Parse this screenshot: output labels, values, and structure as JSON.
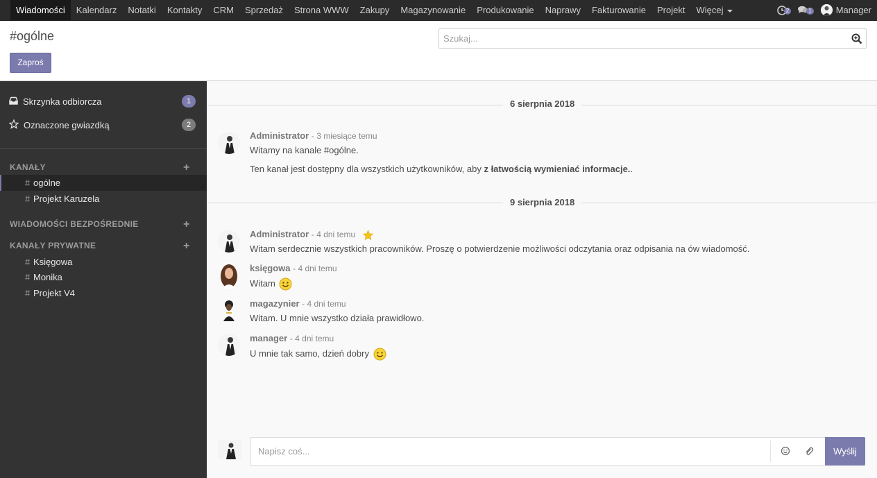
{
  "navbar": {
    "menu": [
      "Wiadomości",
      "Kalendarz",
      "Notatki",
      "Kontakty",
      "CRM",
      "Sprzedaż",
      "Strona WWW",
      "Zakupy",
      "Magazynowanie",
      "Produkowanie",
      "Naprawy",
      "Fakturowanie",
      "Projekt",
      "Więcej"
    ],
    "active_index": 0,
    "activity_count": "2",
    "messages_count": "1",
    "user_name": "Manager"
  },
  "control_panel": {
    "title": "#ogólne",
    "invite_label": "Zaproś",
    "search_placeholder": "Szukaj..."
  },
  "sidebar": {
    "mailboxes": [
      {
        "label": "Skrzynka odbiorcza",
        "count": "1",
        "color": "#7c7bad"
      },
      {
        "label": "Oznaczone gwiazdką",
        "count": "2",
        "color": "#7c7c7c"
      }
    ],
    "channels_heading": "KANAŁY",
    "channels": [
      "ogólne",
      "Projekt Karuzela"
    ],
    "direct_heading": "WIADOMOŚCI BEZPOŚREDNIE",
    "private_heading": "KANAŁY PRYWATNE",
    "private_channels": [
      "Księgowa",
      "Monika",
      "Projekt V4"
    ]
  },
  "thread": {
    "dates": [
      "6 sierpnia 2018",
      "9 sierpnia 2018"
    ],
    "messages": [
      {
        "author": "Administrator",
        "time": "- 3 miesiące temu",
        "lines": [
          "Witamy na kanale #ogólne."
        ],
        "extra_before": "Ten kanał jest dostępny dla wszystkich użytkowników, aby ",
        "extra_bold": "z łatwością wymieniać informacje.",
        "extra_after": "."
      },
      {
        "author": "Administrator",
        "time": "- 4 dni temu",
        "text": "Witam serdecznie wszystkich pracowników. Proszę o potwierdzenie możliwości odczytania oraz odpisania na ów wiadomość."
      },
      {
        "author": "księgowa",
        "time": "- 4 dni temu",
        "text": "Witam"
      },
      {
        "author": "magazynier",
        "time": "- 4 dni temu",
        "text": "Witam. U mnie wszystko działa prawidłowo."
      },
      {
        "author": "manager",
        "time": "- 4 dni temu",
        "text": "U mnie tak samo, dzień dobry"
      }
    ]
  },
  "composer": {
    "placeholder": "Napisz coś...",
    "send_label": "Wyślij"
  },
  "colors": {
    "accent": "#7c7bad",
    "sidebar_bg": "#333333",
    "topbar_bg": "#2b2b2b"
  }
}
